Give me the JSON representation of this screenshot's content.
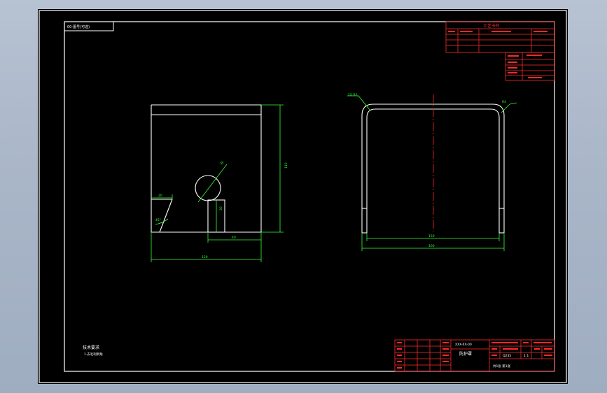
{
  "colors": {
    "frame": "#ffffff",
    "title_block": "#ff2a2a",
    "dimension": "#33ff33",
    "center_line": "#ff2a2a",
    "text_white": "#ffffff",
    "text_green": "#33ff33",
    "background": "#000000"
  },
  "drawing_no_box": {
    "text": "00-图号(可选)"
  },
  "process_card": {
    "title": "工艺卡片"
  },
  "left_view": {
    "dims": {
      "height": "110",
      "width": "120",
      "slot_width": "40",
      "slot_depth": "30",
      "chamfer": "20",
      "angle": "45°",
      "hole": "Ø"
    }
  },
  "right_view": {
    "dims": {
      "radius_left": "2X R2",
      "radius_right": "R4",
      "inner_width": "150",
      "outer_width": "160"
    }
  },
  "notes": {
    "heading": "技术要求",
    "items": [
      "1.去毛刺倒角"
    ]
  },
  "title_block": {
    "part_name": "防护罩",
    "drawing_code": "XXX-XX-00",
    "material": "Q235",
    "scale": "1:1",
    "sheet": "共1张 第1张"
  }
}
